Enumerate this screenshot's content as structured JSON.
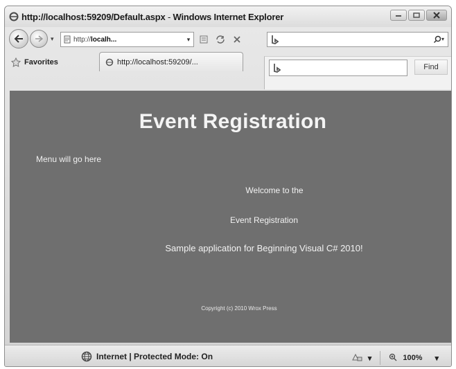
{
  "window": {
    "title_url": "http://localhost:59209/Default.aspx",
    "title_separator": " - ",
    "title_app": "Windows Internet Explorer"
  },
  "address": {
    "prefix": "http://",
    "host": "localh...",
    "dropdown": "▾"
  },
  "search": {
    "value": "",
    "go": "▾"
  },
  "favorites": {
    "label": "Favorites"
  },
  "tab": {
    "label": "http://localhost:59209/..."
  },
  "findbar": {
    "button": "Find",
    "value": ""
  },
  "page": {
    "title": "Event Registration",
    "menu_placeholder": "Menu will go here",
    "welcome_line1": "Welcome to the",
    "welcome_line2": "Event Registration",
    "welcome_line3": "Sample application for Beginning Visual C# 2010!",
    "copyright": "Copyright (c) 2010 Wrox Press"
  },
  "status": {
    "zone": "Internet | Protected Mode: On",
    "zoom": "100%",
    "zoom_dropdown": "▾",
    "protection_dropdown": "▾"
  },
  "colors": {
    "content_bg": "#6f6f6f",
    "text_light": "#f4f4f4",
    "chrome": "#dcdcdc"
  }
}
